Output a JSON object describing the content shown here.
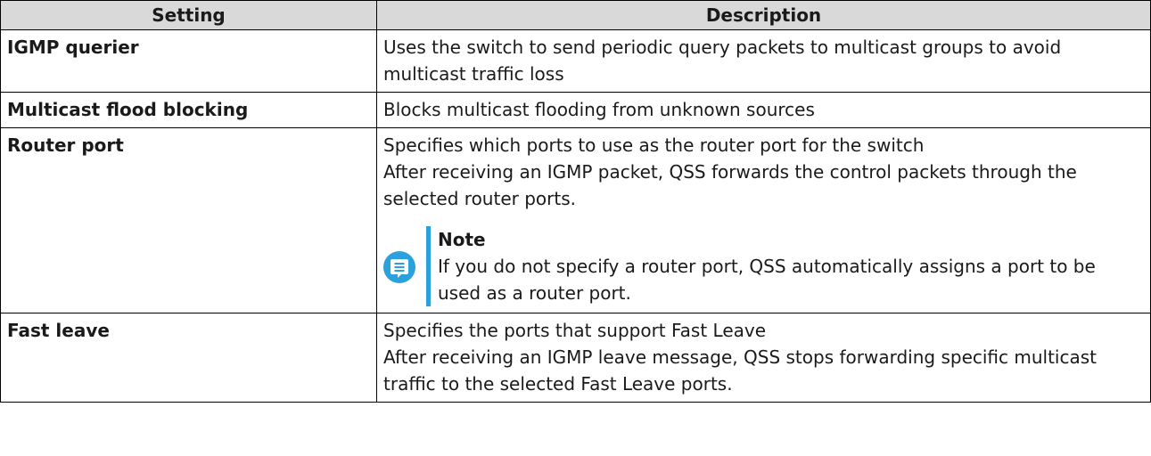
{
  "table": {
    "headers": [
      "Setting",
      "Description"
    ],
    "rows": [
      {
        "setting": "IGMP querier",
        "description": [
          "Uses the switch to send periodic query packets to multicast groups to avoid multicast traffic loss"
        ]
      },
      {
        "setting": "Multicast flood blocking",
        "description": [
          "Blocks multicast flooding from unknown sources"
        ]
      },
      {
        "setting": "Router port",
        "description": [
          "Specifies which ports to use as the router port for the switch",
          "After receiving an IGMP packet, QSS forwards the control packets through the selected router ports."
        ],
        "note": {
          "title": "Note",
          "text": "If you do not specify a router port, QSS automatically assigns a port to be used as a router port.",
          "icon": "note-icon",
          "accent_color": "#2aa0dc"
        }
      },
      {
        "setting": "Fast leave",
        "description": [
          "Specifies the ports that support Fast Leave",
          "After receiving an IGMP leave message, QSS stops forwarding specific multicast traffic to the selected Fast Leave ports."
        ]
      }
    ]
  },
  "colors": {
    "header_background": "#d9d9d9",
    "border": "#000000",
    "note_accent": "#2aa0dc"
  }
}
